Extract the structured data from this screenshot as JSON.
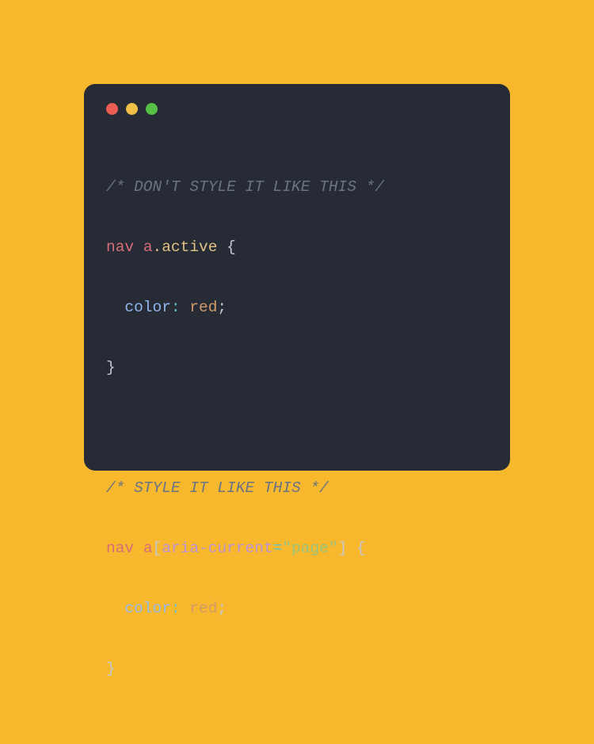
{
  "window": {
    "traffic_lights": [
      "close",
      "minimize",
      "zoom"
    ]
  },
  "code": {
    "block1": {
      "comment": "/* DON'T STYLE IT LIKE THIS */",
      "selector_tag1": "nav",
      "selector_tag2": "a",
      "selector_classdot": ".",
      "selector_classname": "active",
      "brace_open": " {",
      "prop": "color",
      "colon": ":",
      "value": " red",
      "semicolon": ";",
      "brace_close": "}"
    },
    "block2": {
      "comment": "/* STYLE IT LIKE THIS */",
      "selector_tag1": "nav",
      "selector_tag2": "a",
      "bracket_open": "[",
      "attr_name": "aria-current",
      "eq": "=",
      "attr_value": "\"page\"",
      "bracket_close": "]",
      "brace_open": " {",
      "prop": "color",
      "colon": ":",
      "value": " red",
      "semicolon": ";",
      "brace_close": "}"
    }
  }
}
